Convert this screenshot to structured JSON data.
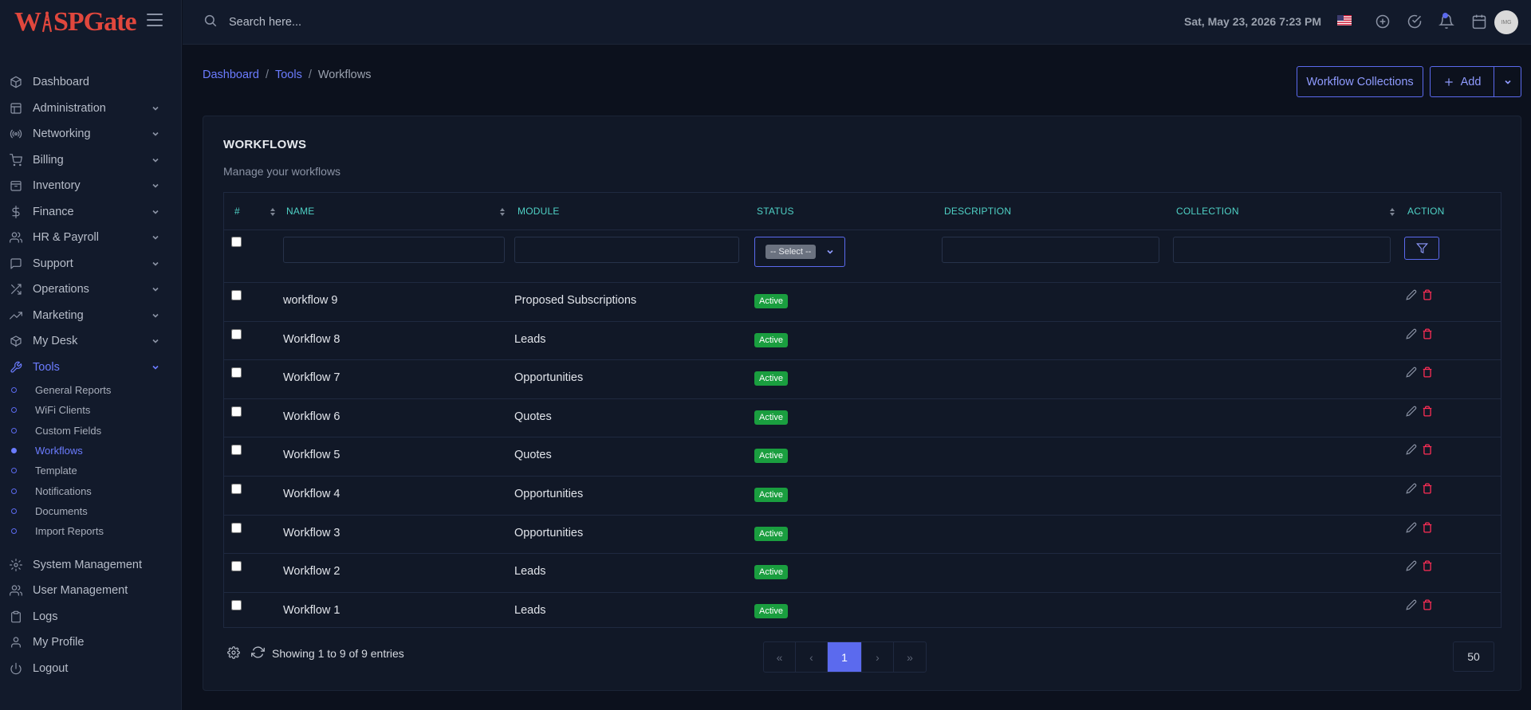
{
  "app": {
    "logo_prefix": "W",
    "logo_suffix": "SPGate"
  },
  "header": {
    "search_placeholder": "Search here...",
    "datetime": "Sat, May 23, 2026 7:23 PM",
    "avatar_text": "IMG"
  },
  "sidebar": {
    "items": [
      {
        "label": "Dashboard",
        "icon": "cube-icon",
        "chevron": false
      },
      {
        "label": "Administration",
        "icon": "layout-icon",
        "chevron": true
      },
      {
        "label": "Networking",
        "icon": "broadcast-icon",
        "chevron": true
      },
      {
        "label": "Billing",
        "icon": "cart-icon",
        "chevron": true
      },
      {
        "label": "Inventory",
        "icon": "archive-icon",
        "chevron": true
      },
      {
        "label": "Finance",
        "icon": "dollar-icon",
        "chevron": true
      },
      {
        "label": "HR & Payroll",
        "icon": "users-icon",
        "chevron": true
      },
      {
        "label": "Support",
        "icon": "message-icon",
        "chevron": true
      },
      {
        "label": "Operations",
        "icon": "shuffle-icon",
        "chevron": true
      },
      {
        "label": "Marketing",
        "icon": "trending-icon",
        "chevron": true
      },
      {
        "label": "My Desk",
        "icon": "box-icon",
        "chevron": true
      },
      {
        "label": "Tools",
        "icon": "wrench-icon",
        "chevron": true,
        "active": true
      }
    ],
    "tools_sub": [
      {
        "label": "General Reports"
      },
      {
        "label": "WiFi Clients"
      },
      {
        "label": "Custom Fields"
      },
      {
        "label": "Workflows",
        "active": true
      },
      {
        "label": "Template"
      },
      {
        "label": "Notifications"
      },
      {
        "label": "Documents"
      },
      {
        "label": "Import Reports"
      }
    ],
    "bottom_items": [
      {
        "label": "System Management",
        "icon": "gear-icon"
      },
      {
        "label": "User Management",
        "icon": "users-icon"
      },
      {
        "label": "Logs",
        "icon": "clipboard-icon"
      },
      {
        "label": "My Profile",
        "icon": "user-icon"
      },
      {
        "label": "Logout",
        "icon": "power-icon"
      }
    ]
  },
  "breadcrumb": {
    "home": "Dashboard",
    "section": "Tools",
    "current": "Workflows",
    "sep": "/"
  },
  "actions": {
    "collections_label": "Workflow Collections",
    "add_label": "Add"
  },
  "card": {
    "title": "WORKFLOWS",
    "subtitle": "Manage your workflows"
  },
  "table": {
    "columns": {
      "num": "#",
      "name": "NAME",
      "module": "MODULE",
      "status": "STATUS",
      "description": "DESCRIPTION",
      "collection": "COLLECTION",
      "action": "ACTION"
    },
    "status_filter_value": "-- Select --",
    "rows": [
      {
        "name": "workflow 9",
        "module": "Proposed Subscriptions",
        "status": "Active"
      },
      {
        "name": "Workflow 8",
        "module": "Leads",
        "status": "Active"
      },
      {
        "name": "Workflow 7",
        "module": "Opportunities",
        "status": "Active"
      },
      {
        "name": "Workflow 6",
        "module": "Quotes",
        "status": "Active"
      },
      {
        "name": "Workflow 5",
        "module": "Quotes",
        "status": "Active"
      },
      {
        "name": "Workflow 4",
        "module": "Opportunities",
        "status": "Active"
      },
      {
        "name": "Workflow 3",
        "module": "Opportunities",
        "status": "Active"
      },
      {
        "name": "Workflow 2",
        "module": "Leads",
        "status": "Active"
      },
      {
        "name": "Workflow 1",
        "module": "Leads",
        "status": "Active"
      }
    ]
  },
  "footer": {
    "showing_text": "Showing 1 to 9 of 9 entries",
    "pager": {
      "first": "«",
      "prev": "‹",
      "current": "1",
      "next": "›",
      "last": "»"
    },
    "page_size": "50"
  },
  "colors": {
    "accent": "#5b6aee",
    "active_badge": "#1a9e3f",
    "delete": "#ff2d55",
    "column_header": "#4fd1c5",
    "logo": "#e0473d"
  }
}
